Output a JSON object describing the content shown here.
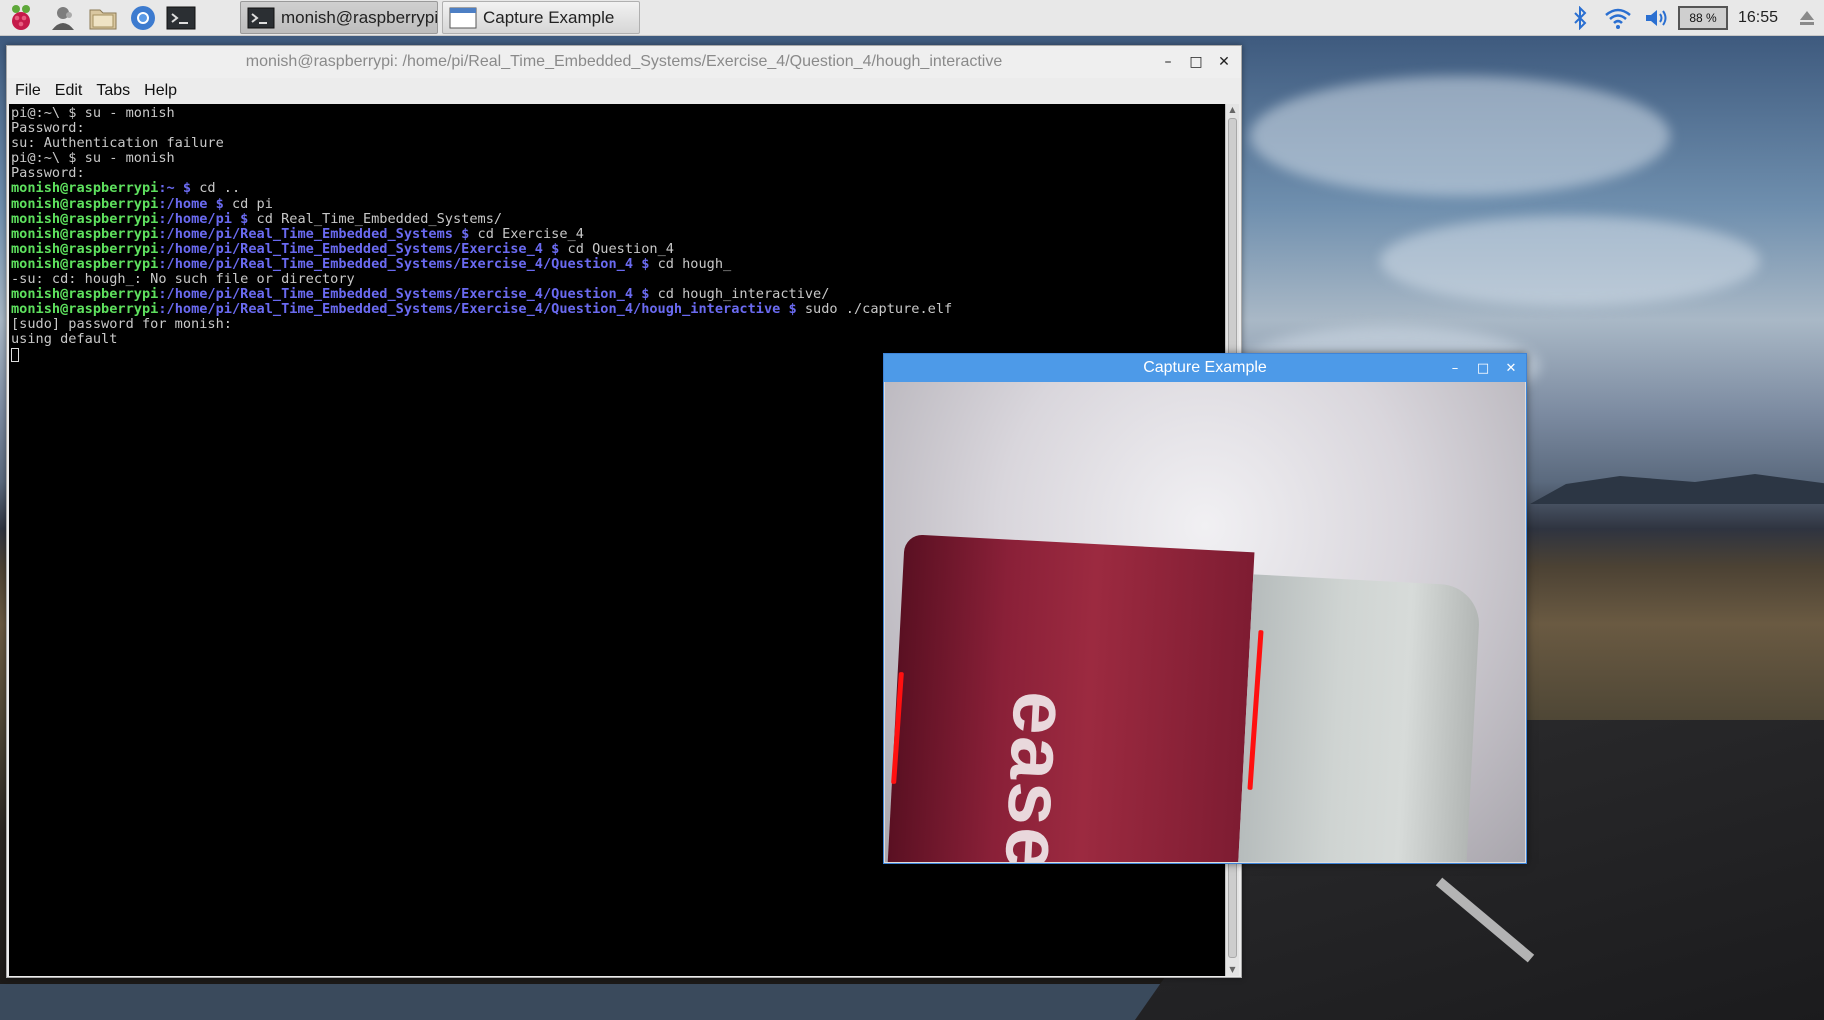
{
  "panel": {
    "launchers": [
      {
        "name": "raspberry-menu-icon"
      },
      {
        "name": "users-icon"
      },
      {
        "name": "file-manager-icon"
      },
      {
        "name": "chromium-browser-icon"
      },
      {
        "name": "terminal-launcher-icon"
      }
    ],
    "tasks": [
      {
        "label": "monish@raspberrypi:...",
        "icon": "terminal-icon"
      },
      {
        "label": "Capture Example",
        "icon": "window-icon"
      }
    ],
    "tray": {
      "bluetooth": "bluetooth-icon",
      "wifi": "wifi-icon",
      "volume": "volume-icon",
      "battery": "88 %",
      "clock": "16:55",
      "eject": "eject-icon"
    }
  },
  "terminal": {
    "title": "monish@raspberrypi: /home/pi/Real_Time_Embedded_Systems/Exercise_4/Question_4/hough_interactive",
    "controls": {
      "minimize": "–",
      "maximize": "□",
      "close": "✕"
    },
    "menu": [
      "File",
      "Edit",
      "Tabs",
      "Help"
    ],
    "lines": [
      [
        {
          "t": "pi@:~\\ $ su - monish",
          "c": "w"
        }
      ],
      [
        {
          "t": "Password:",
          "c": "w"
        }
      ],
      [
        {
          "t": "su: Authentication failure",
          "c": "w"
        }
      ],
      [
        {
          "t": "pi@:~\\ $ su - monish",
          "c": "w"
        }
      ],
      [
        {
          "t": "Password:",
          "c": "w"
        }
      ],
      [
        {
          "t": "monish@raspberrypi",
          "c": "g"
        },
        {
          "t": ":~ $ ",
          "c": "b"
        },
        {
          "t": "cd ..",
          "c": "w"
        }
      ],
      [
        {
          "t": "monish@raspberrypi",
          "c": "g"
        },
        {
          "t": ":/home $ ",
          "c": "b"
        },
        {
          "t": "cd pi",
          "c": "w"
        }
      ],
      [
        {
          "t": "monish@raspberrypi",
          "c": "g"
        },
        {
          "t": ":/home/pi $ ",
          "c": "b"
        },
        {
          "t": "cd Real_Time_Embedded_Systems/",
          "c": "w"
        }
      ],
      [
        {
          "t": "monish@raspberrypi",
          "c": "g"
        },
        {
          "t": ":/home/pi/Real_Time_Embedded_Systems $ ",
          "c": "b"
        },
        {
          "t": "cd Exercise_4",
          "c": "w"
        }
      ],
      [
        {
          "t": "monish@raspberrypi",
          "c": "g"
        },
        {
          "t": ":/home/pi/Real_Time_Embedded_Systems/Exercise_4 $ ",
          "c": "b"
        },
        {
          "t": "cd Question_4",
          "c": "w"
        }
      ],
      [
        {
          "t": "monish@raspberrypi",
          "c": "g"
        },
        {
          "t": ":/home/pi/Real_Time_Embedded_Systems/Exercise_4/Question_4 $ ",
          "c": "b"
        },
        {
          "t": "cd hough_",
          "c": "w"
        }
      ],
      [
        {
          "t": "-su: cd: hough_: No such file or directory",
          "c": "w"
        }
      ],
      [
        {
          "t": "monish@raspberrypi",
          "c": "g"
        },
        {
          "t": ":/home/pi/Real_Time_Embedded_Systems/Exercise_4/Question_4 $ ",
          "c": "b"
        },
        {
          "t": "cd hough_interactive/",
          "c": "w"
        }
      ],
      [
        {
          "t": "monish@raspberrypi",
          "c": "g"
        },
        {
          "t": ":/home/pi/Real_Time_Embedded_Systems/Exercise_4/Question_4/hough_interactive $ ",
          "c": "b"
        },
        {
          "t": "sudo ./capture.elf",
          "c": "w"
        }
      ],
      [
        {
          "t": "[sudo] password for monish:",
          "c": "w"
        }
      ],
      [
        {
          "t": "using default",
          "c": "w"
        }
      ]
    ]
  },
  "capture": {
    "title": "Capture Example",
    "controls": {
      "minimize": "–",
      "maximize": "□",
      "close": "✕"
    },
    "label_text": "ease"
  },
  "colors": {
    "prompt_user": "#5ee05e",
    "prompt_path": "#6a6af0",
    "capture_titlebar": "#4d9ae8",
    "hough_line": "#ff1010"
  }
}
